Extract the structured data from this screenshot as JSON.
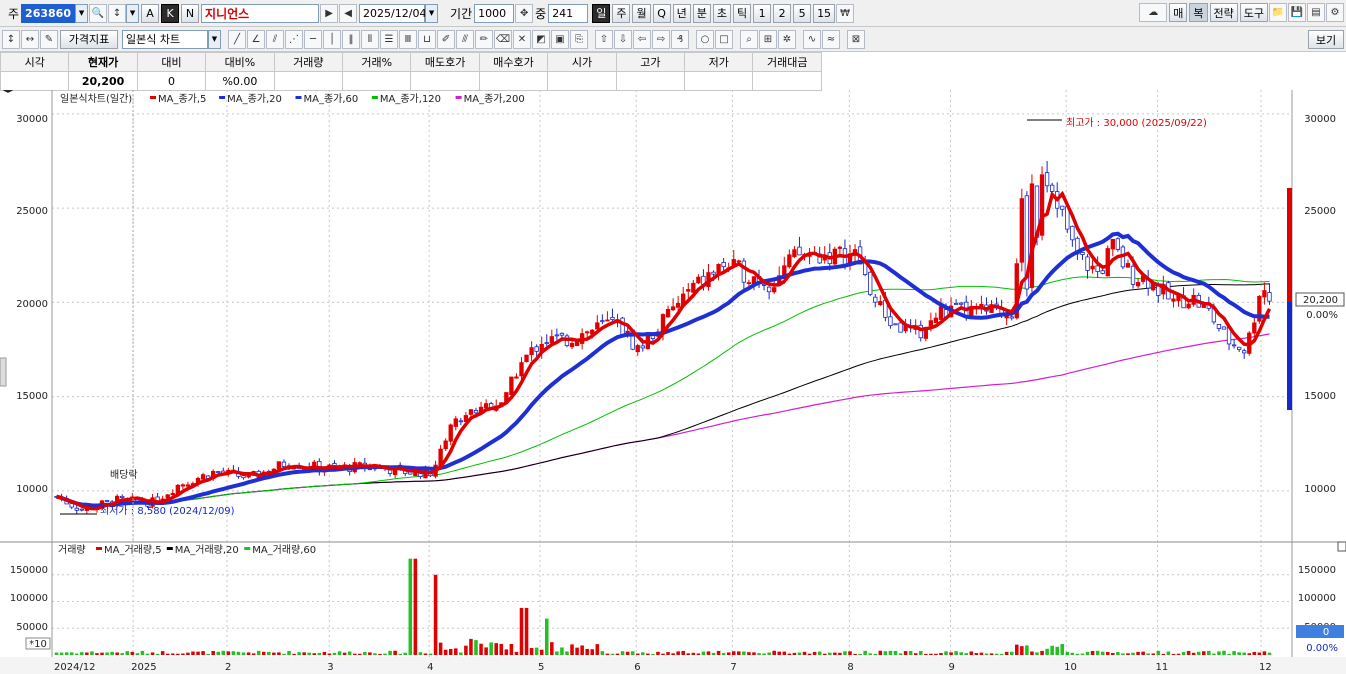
{
  "toolbar1": {
    "prefix": "주",
    "code": "263860",
    "name": "지니언스",
    "date": "2025/12/04",
    "period_label": "기간",
    "period_value": "1000",
    "count_label": "중",
    "count_value": "241",
    "mode_a": "A",
    "mode_k": "K",
    "mode_n": "N",
    "timeframes": [
      "일",
      "주",
      "월",
      "Q",
      "년",
      "분",
      "초",
      "틱",
      "1",
      "2",
      "5",
      "15"
    ],
    "right_buttons": [
      "매",
      "복",
      "전략",
      "도구"
    ]
  },
  "toolbar2": {
    "indicator": "가격지표",
    "chart_type": "일본식 차트",
    "view": "보기"
  },
  "quote": {
    "headers": [
      "시각",
      "현재가",
      "대비",
      "대비%",
      "거래량",
      "거래%",
      "매도호가",
      "매수호가",
      "시가",
      "고가",
      "저가",
      "거래대금"
    ],
    "values": [
      "",
      "20,200",
      "0",
      "%0.00",
      "",
      "",
      "",
      "",
      "",
      "",
      "",
      ""
    ]
  },
  "price_legend": {
    "title": "일본식차트(일간)",
    "items": [
      "MA_종가,5",
      "MA_종가,20",
      "MA_종가,60",
      "MA_종가,120",
      "MA_종가,200"
    ]
  },
  "volume_legend": {
    "title": "거래량",
    "items": [
      "MA_거래량,5",
      "MA_거래량,20",
      "MA_거래량,60"
    ]
  },
  "annotations": {
    "high": "최고가 : 30,000 (2025/09/22)",
    "low": "최저가 : 8,580 (2024/12/09)",
    "dividend": "배당락",
    "scale_badge": "*10"
  },
  "price_axis": [
    "30000",
    "25000",
    "20000",
    "15000",
    "10000"
  ],
  "volume_axis": [
    "150000",
    "100000",
    "50000",
    "10000"
  ],
  "right_panel": {
    "last_price": "20,200",
    "last_pct": "0.00%",
    "volume_last": "0",
    "volume_pct": "0.00%"
  },
  "x_axis": [
    "2024/12",
    "2025",
    "2",
    "3",
    "4",
    "5",
    "6",
    "7",
    "8",
    "9",
    "10",
    "11",
    "12"
  ],
  "colors": {
    "up": "#e00000",
    "down": "#1428c8",
    "ma5": "#e00000",
    "ma20": "#1e2fd6",
    "ma60": "#00c000",
    "ma120": "#000000",
    "ma200": "#d020d0",
    "code_bg": "#1e5fcf"
  },
  "chart_data": {
    "type": "candlestick",
    "y_range": [
      7500,
      31000
    ],
    "x": [
      "2024-12",
      "2025-01",
      "2025-02",
      "2025-03",
      "2025-04",
      "2025-05",
      "2025-06",
      "2025-07",
      "2025-08",
      "2025-09",
      "2025-10",
      "2025-11",
      "2025-12"
    ],
    "close_approx": [
      9600,
      9600,
      10900,
      11200,
      11000,
      18000,
      18000,
      22500,
      21500,
      19200,
      25000,
      20800,
      20200
    ],
    "high": 30000,
    "high_date": "2025-09-22",
    "low": 8580,
    "low_date": "2024-12-09",
    "last": 20200,
    "volume_max": 180000
  }
}
